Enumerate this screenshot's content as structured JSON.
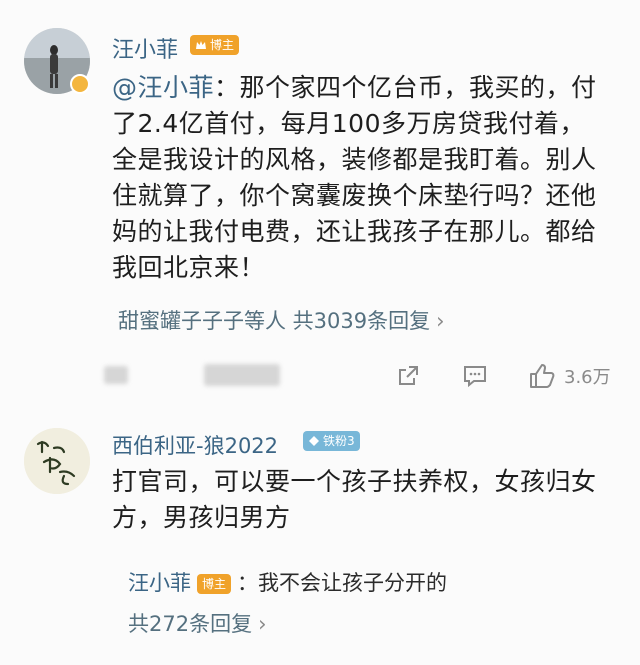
{
  "comment1": {
    "username": "汪小菲",
    "badge": "博主",
    "mention": "@汪小菲",
    "text_lines": [
      "：那个家四个亿台币，我买的，付",
      "了2.4亿首付，每月100多万房贷我付着，",
      "全是我设计的风格，装修都是我盯着。别人",
      "住就算了，你个窝囊废换个床垫行吗？还他",
      "妈的让我付电费，还让我孩子在那儿。都给",
      "我回北京来！"
    ],
    "reply_summary": "甜蜜罐子子子等人 共3039条回复",
    "actions": {
      "like_count": "3.6万"
    },
    "colors": {
      "badge": "#f0a22a",
      "link": "#3b6585"
    }
  },
  "comment2": {
    "username": "西伯利亚-狼2022",
    "badge": "铁粉3",
    "text_lines": [
      "打官司，可以要一个孩子扶养权，女孩归女",
      "方，男孩归男方"
    ],
    "sub_reply": {
      "username": "汪小菲",
      "badge": "博主",
      "text": "：我不会让孩子分开的"
    },
    "reply_summary": "共272条回复",
    "colors": {
      "badge": "#78b7d8"
    }
  },
  "icons": [
    "chevron-right-icon",
    "share-icon",
    "comment-icon",
    "like-icon",
    "fan-badge-icon",
    "author-badge-icon"
  ]
}
